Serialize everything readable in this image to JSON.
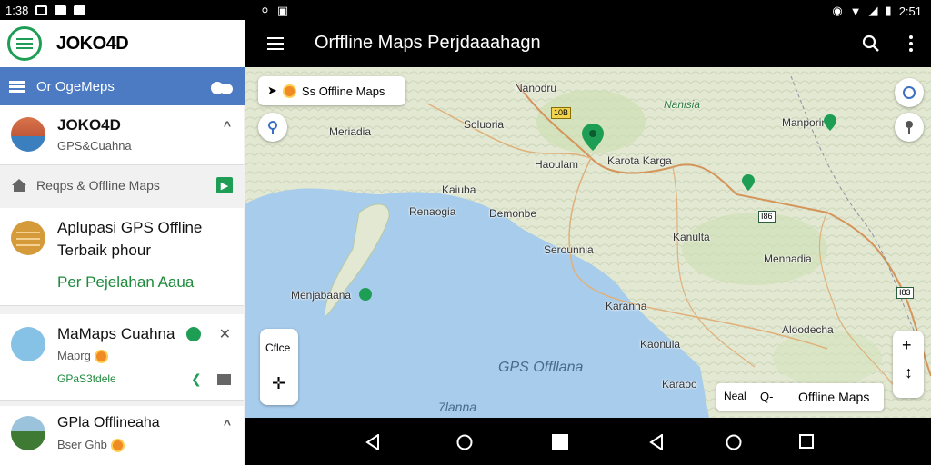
{
  "status_left": {
    "time": "1:38"
  },
  "status_right": {
    "time": "2:51"
  },
  "brand": {
    "name": "JOKO4D"
  },
  "bluebar": {
    "label": "Or OgeMeps"
  },
  "cards": {
    "joko": {
      "title": "JOKO4D",
      "subtitle": "GPS&Cuahna"
    },
    "home_row": {
      "label": "Reqps & Offline Maps"
    },
    "app": {
      "line1": "Aplupasi GPS Offline",
      "line2": "Terbaik phour",
      "line3": "Per Pejelahan Aaua"
    },
    "maps": {
      "title": "MaMaps Cuahna",
      "subtitle": "Maprg",
      "link": "GPaS3tdele"
    },
    "gps": {
      "title": "GPla Offlineaha",
      "subtitle": "Bser Ghb"
    }
  },
  "appbar": {
    "title": "Orffline Maps Perjdaaahagn"
  },
  "map": {
    "chip_top": "Ss Offline Maps",
    "zoom_label": "Cflce",
    "bottom_chip": {
      "left": "Neal",
      "search": "Q-",
      "label": "Offline Maps"
    },
    "water_label": "GPS Offllana",
    "water_label2": "7lanna",
    "places": {
      "p1": "Nanodru",
      "p2": "Nanisia",
      "p3": "Manporina",
      "p4": "Soluoria",
      "p5": "Meriadia",
      "p6": "Haoulam",
      "p7": "Karota Karga",
      "p8": "Kaiuba",
      "p9": "Renaogia",
      "p10": "Demonbe",
      "p11": "Kanulta",
      "p12": "Serounnia",
      "p13": "Mennadia",
      "p14": "Menjabaana",
      "p15": "Karanna",
      "p16": "Aloodecha",
      "p17": "Kaonula",
      "p18": "Karaoo"
    },
    "roads": {
      "r1": "10B",
      "r2": "I86",
      "r3": "I83"
    }
  },
  "colors": {
    "accent_green": "#1e9e54",
    "blue_bar": "#4c7bc4",
    "sea": "#a8cdec"
  }
}
